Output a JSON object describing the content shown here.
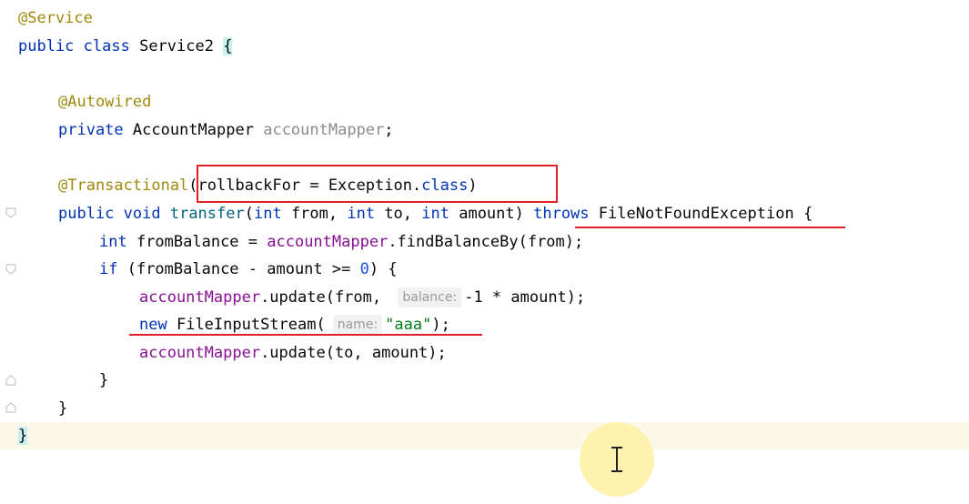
{
  "lines": {
    "l1": {
      "ann": "@Service"
    },
    "l2": {
      "kw": "public class",
      "name": "Service2",
      "brace": "{"
    },
    "l4": {
      "ann": "@Autowired"
    },
    "l5": {
      "kw": "private",
      "type": "AccountMapper",
      "field": "accountMapper",
      "end": ";"
    },
    "l7": {
      "ann": "@Transactional",
      "args": "(rollbackFor = Exception.",
      "cls": "class",
      "close": ")"
    },
    "l8": {
      "kw1": "public void",
      "method": "transfer",
      "p1": "(",
      "t1": "int",
      "a1": " from, ",
      "t2": "int",
      "a2": " to, ",
      "t3": "int",
      "a3": " amount) ",
      "throws": "throws",
      "exc": "FileNotFoundException {"
    },
    "l9": {
      "kw": "int",
      "rest": " fromBalance = ",
      "field": "accountMapper",
      "call": ".findBalanceBy(from);"
    },
    "l10": {
      "kw": "if",
      "rest": " (fromBalance - amount >= ",
      "num": "0",
      "end": ") {"
    },
    "l11": {
      "field": "accountMapper",
      "call": ".update(from, ",
      "hint": "balance:",
      "val": "-1 * amount);"
    },
    "l12": {
      "kw": "new",
      "cls": "FileInputStream(",
      "hint": "name:",
      "str": "\"aaa\"",
      "end": ");"
    },
    "l13": {
      "field": "accountMapper",
      "call": ".update(to, amount);"
    },
    "l14": {
      "brace": "}"
    },
    "l15": {
      "brace": "}"
    },
    "l16": {
      "brace": "}"
    }
  },
  "colors": {
    "annotation_highlight": "#e0202a",
    "current_line": "#fbf8e8",
    "cursor_halo": "#fff1a8"
  },
  "icons": {
    "cursor": "text-cursor-icon",
    "fold": "fold-marker-icon"
  }
}
